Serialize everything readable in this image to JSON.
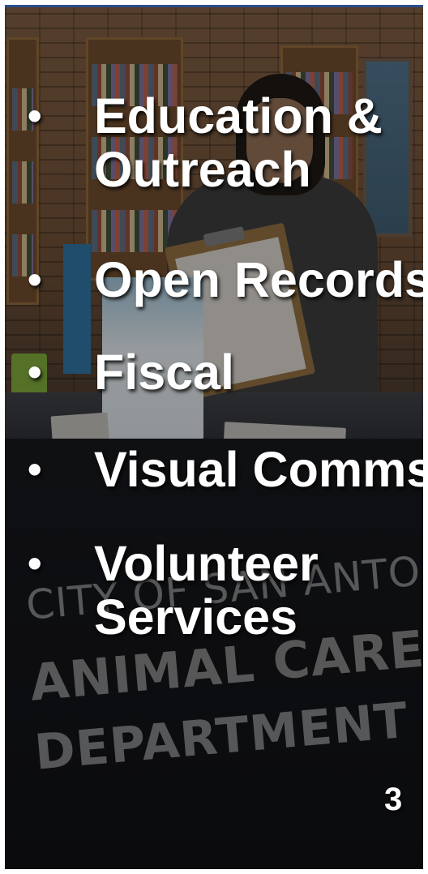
{
  "slide": {
    "bullets": [
      {
        "marker": "•",
        "text": "Education & Outreach"
      },
      {
        "marker": "•",
        "text": "Open Records"
      },
      {
        "marker": "•",
        "text": "Fiscal"
      },
      {
        "marker": "•",
        "text": "Visual Comms"
      },
      {
        "marker": "•",
        "text": "Volunteer Services"
      }
    ],
    "page_number": "3"
  },
  "background_photo": {
    "tablecloth_text": {
      "line1": "CITY OF SAN ANTONIO",
      "line2": "ANIMAL CARE SERVICES",
      "line3": "DEPARTMENT"
    }
  },
  "colors": {
    "text": "#ffffff",
    "accent_strip": "#2a4e8a"
  }
}
